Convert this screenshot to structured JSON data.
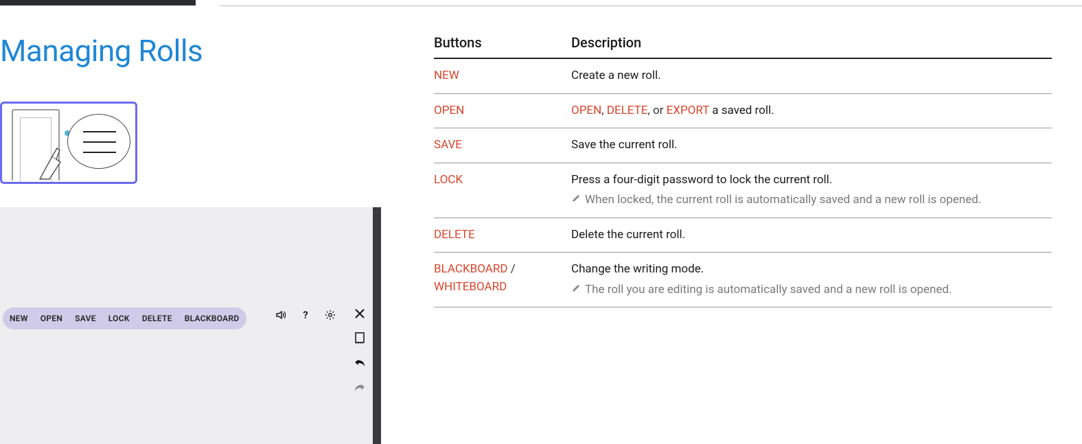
{
  "title": "Managing Rolls",
  "toolbar": {
    "new": "NEW",
    "open": "OPEN",
    "save": "SAVE",
    "lock": "LOCK",
    "delete": "DELETE",
    "blackboard": "BLACKBOARD"
  },
  "help_glyph": "?",
  "table": {
    "headers": {
      "buttons": "Buttons",
      "description": "Description"
    },
    "rows": {
      "new": {
        "btn": "NEW",
        "desc": "Create a new roll."
      },
      "open": {
        "btn": "OPEN",
        "desc_pre": "",
        "kw1": "OPEN",
        "sep1": ", ",
        "kw2": "DELETE",
        "sep2": ", or ",
        "kw3": "EXPORT",
        "desc_post": " a saved roll."
      },
      "save": {
        "btn": "SAVE",
        "desc": "Save the current roll."
      },
      "lock": {
        "btn": "LOCK",
        "desc": "Press a four-digit password to lock the current roll.",
        "note": "When locked, the current roll is automatically saved and a new roll is opened."
      },
      "delete": {
        "btn": "DELETE",
        "desc": "Delete the current roll."
      },
      "mode": {
        "btn1": "BLACKBOARD",
        "btn_sep": " / ",
        "btn2": "WHITEBOARD",
        "desc": "Change the writing mode.",
        "note": "The roll you are editing is automatically saved and a new roll is opened."
      }
    }
  }
}
